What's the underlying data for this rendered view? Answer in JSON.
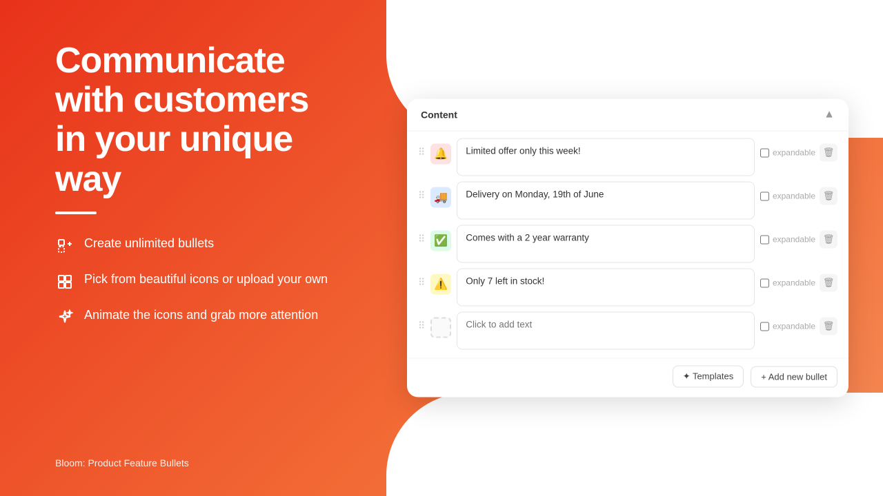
{
  "background": {
    "gradient_start": "#e8321a",
    "gradient_end": "#f58a55"
  },
  "left": {
    "headline": "Communicate with customers in your unique way",
    "divider": true,
    "features": [
      {
        "id": "feature-1",
        "icon": "bullets-add-icon",
        "text": "Create unlimited bullets"
      },
      {
        "id": "feature-2",
        "icon": "grid-icon",
        "text": "Pick from beautiful icons or upload your own"
      },
      {
        "id": "feature-3",
        "icon": "sparkle-icon",
        "text": "Animate the icons and grab more attention"
      }
    ],
    "footer": "Bloom: Product Feature Bullets"
  },
  "panel": {
    "title": "Content",
    "collapse_icon": "▲",
    "bullets": [
      {
        "id": "bullet-1",
        "icon_type": "red",
        "icon_emoji": "🔔",
        "text": "Limited offer only this week!",
        "expandable": false,
        "placeholder": false
      },
      {
        "id": "bullet-2",
        "icon_type": "blue",
        "icon_emoji": "🚚",
        "text": "Delivery on Monday, 19th of June",
        "expandable": false,
        "placeholder": false
      },
      {
        "id": "bullet-3",
        "icon_type": "green",
        "icon_emoji": "✅",
        "text": "Comes with a 2 year warranty",
        "expandable": false,
        "placeholder": false
      },
      {
        "id": "bullet-4",
        "icon_type": "yellow",
        "icon_emoji": "⚠️",
        "text": "Only 7 left in stock!",
        "expandable": false,
        "placeholder": false
      },
      {
        "id": "bullet-5",
        "icon_type": "empty",
        "icon_emoji": "",
        "text": "",
        "expandable": false,
        "placeholder": true,
        "placeholder_text": "Click to add text"
      }
    ],
    "footer": {
      "templates_label": "✦ Templates",
      "add_label": "+ Add new bullet"
    },
    "expandable_label": "expandable"
  }
}
